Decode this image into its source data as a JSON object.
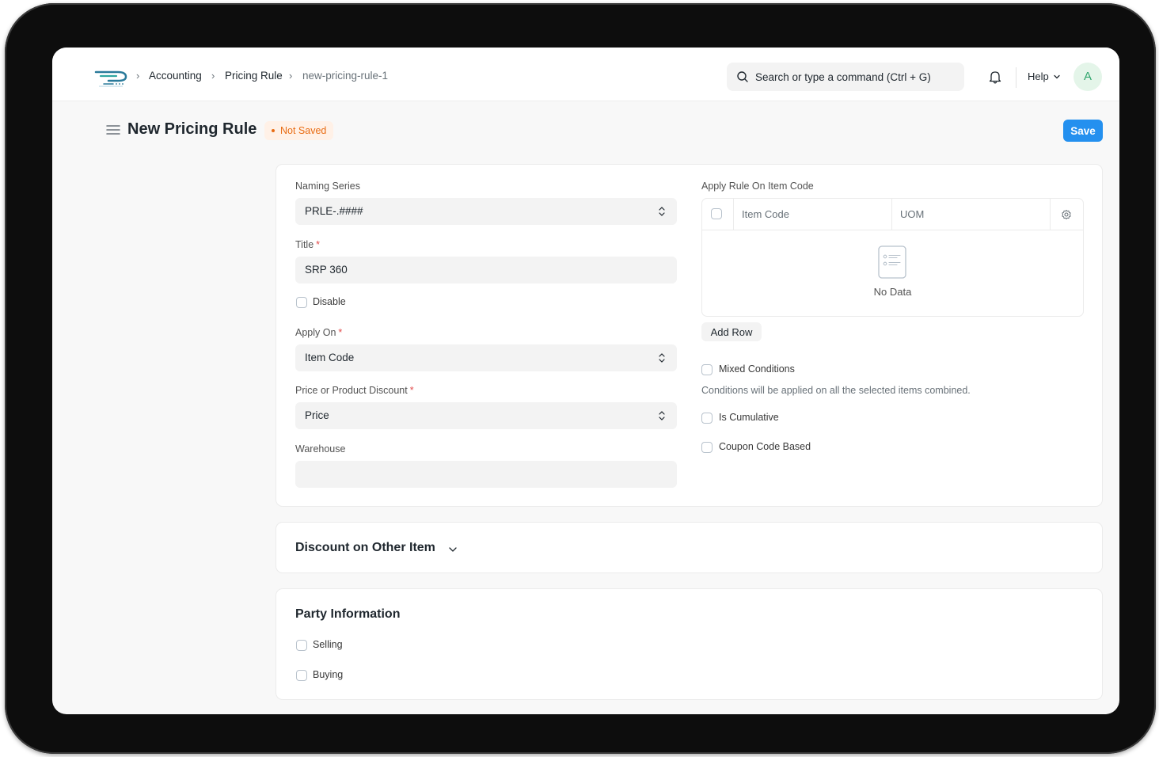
{
  "navbar": {
    "breadcrumbs": [
      "Accounting",
      "Pricing Rule",
      "new-pricing-rule-1"
    ],
    "search_placeholder": "Search or type a command (Ctrl + G)",
    "help_label": "Help",
    "avatar_initial": "A"
  },
  "page": {
    "title": "New Pricing Rule",
    "status": "Not Saved",
    "save_label": "Save"
  },
  "form": {
    "naming_series": {
      "label": "Naming Series",
      "value": "PRLE-.####"
    },
    "title": {
      "label": "Title",
      "required": "*",
      "value": "SRP 360"
    },
    "disable": {
      "label": "Disable"
    },
    "apply_on": {
      "label": "Apply On",
      "required": "*",
      "value": "Item Code"
    },
    "price_or_product": {
      "label": "Price or Product Discount",
      "required": "*",
      "value": "Price"
    },
    "warehouse": {
      "label": "Warehouse",
      "value": ""
    },
    "apply_rule_on": {
      "label": "Apply Rule On Item Code",
      "columns": [
        "Item Code",
        "UOM"
      ],
      "empty_text": "No Data",
      "add_row_label": "Add Row"
    },
    "mixed_conditions": {
      "label": "Mixed Conditions",
      "help": "Conditions will be applied on all the selected items combined."
    },
    "is_cumulative": {
      "label": "Is Cumulative"
    },
    "coupon_code_based": {
      "label": "Coupon Code Based"
    }
  },
  "sections": {
    "discount_other": {
      "title": "Discount on Other Item"
    },
    "party": {
      "title": "Party Information",
      "selling": "Selling",
      "buying": "Buying"
    }
  },
  "colors": {
    "primary": "#2490ef",
    "warning": "#e86c13",
    "avatar": "#30a66d"
  }
}
